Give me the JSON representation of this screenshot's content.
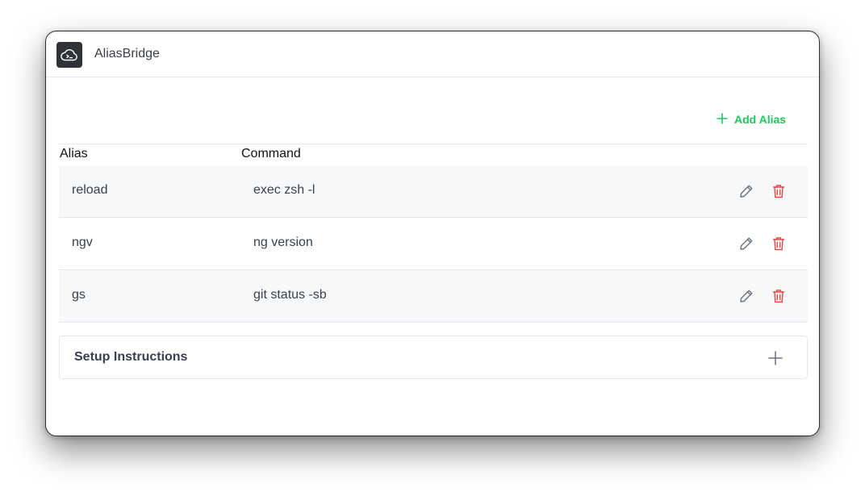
{
  "app": {
    "title": "AliasBridge",
    "logo_icon": "cloud-terminal-icon"
  },
  "toolbar": {
    "add_label": "Add Alias",
    "add_icon": "plus-icon"
  },
  "table": {
    "columns": [
      "Alias",
      "Command"
    ],
    "rows": [
      {
        "alias": "reload",
        "command": "exec zsh -l"
      },
      {
        "alias": "ngv",
        "command": "ng version"
      },
      {
        "alias": "gs",
        "command": "git status -sb"
      }
    ],
    "row_actions": [
      "pencil-icon",
      "trash-icon"
    ]
  },
  "setup": {
    "title": "Setup Instructions",
    "toggle_icon": "plus-icon"
  },
  "colors": {
    "accent": "#22c55e",
    "danger": "#ef4444",
    "icon_muted": "#6b7280",
    "row_shade": "#f7f8fa"
  }
}
